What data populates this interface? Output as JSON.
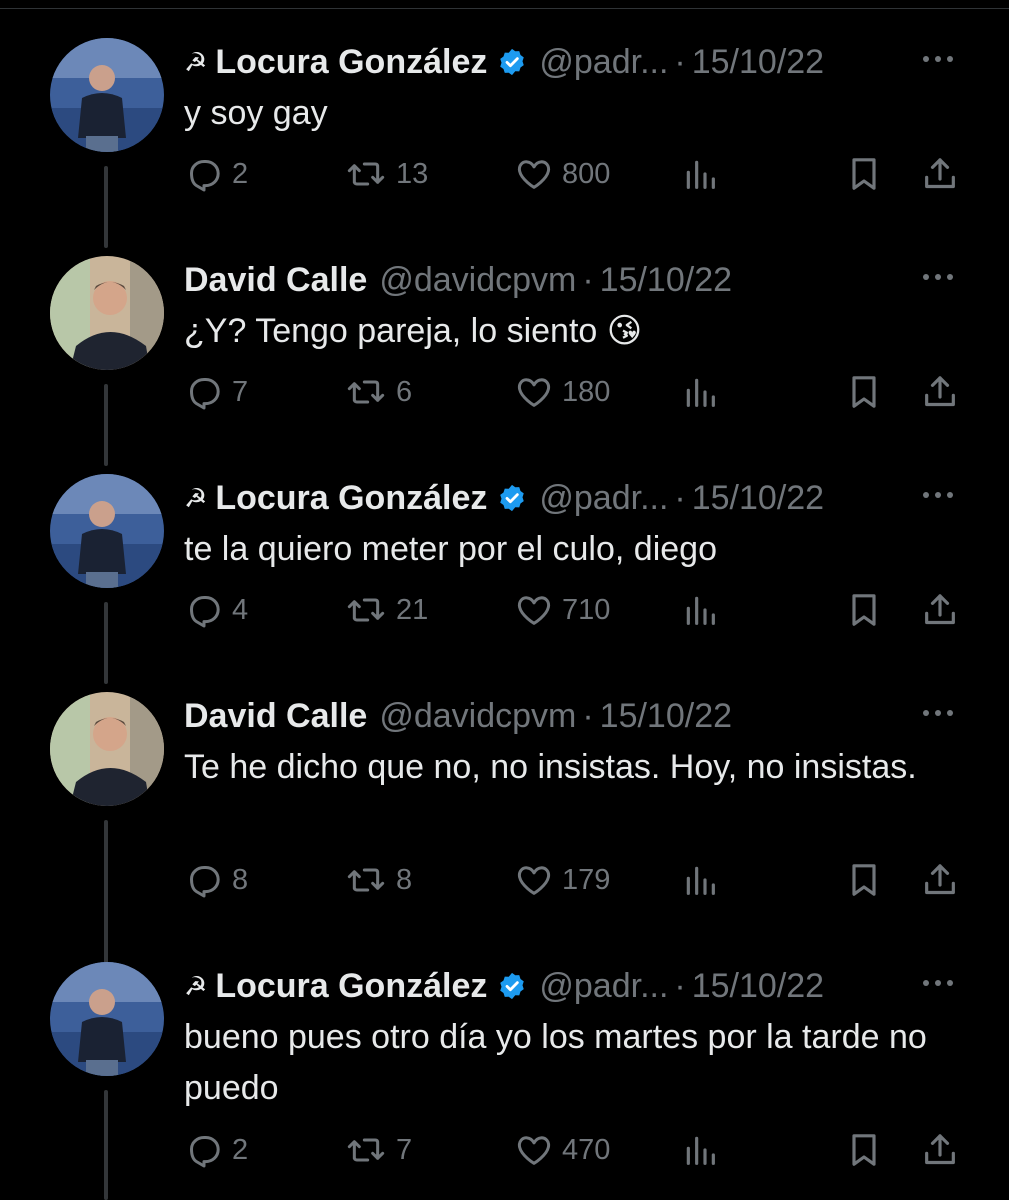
{
  "tweets": [
    {
      "name": "Locura González",
      "prefix_icon": "hammer-sickle-icon",
      "verified": true,
      "handle": "@padr...",
      "sep": "·",
      "date": "15/10/22",
      "text": "y soy gay",
      "replies": "2",
      "retweets": "13",
      "likes": "800",
      "avatar": "locura"
    },
    {
      "name": "David Calle",
      "prefix_icon": "",
      "verified": false,
      "handle": "@davidcpvm",
      "sep": "·",
      "date": "15/10/22",
      "text": "¿Y? Tengo pareja, lo siento 😘",
      "replies": "7",
      "retweets": "6",
      "likes": "180",
      "avatar": "david"
    },
    {
      "name": "Locura González",
      "prefix_icon": "hammer-sickle-icon",
      "verified": true,
      "handle": "@padr...",
      "sep": "·",
      "date": "15/10/22",
      "text": "te la quiero meter por el culo, diego",
      "replies": "4",
      "retweets": "21",
      "likes": "710",
      "avatar": "locura"
    },
    {
      "name": "David Calle",
      "prefix_icon": "",
      "verified": false,
      "handle": "@davidcpvm",
      "sep": "·",
      "date": "15/10/22",
      "text": "Te he dicho que no, no insistas. Hoy, no insistas.",
      "replies": "8",
      "retweets": "8",
      "likes": "179",
      "avatar": "david"
    },
    {
      "name": "Locura González",
      "prefix_icon": "hammer-sickle-icon",
      "verified": true,
      "handle": "@padr...",
      "sep": "·",
      "date": "15/10/22",
      "text": "bueno pues otro día yo los martes por la tarde no puedo",
      "replies": "2",
      "retweets": "7",
      "likes": "470",
      "avatar": "locura"
    }
  ],
  "colors": {
    "background": "#000000",
    "text": "#e7e9ea",
    "muted": "#71767b",
    "verified": "#1d9bf0",
    "thread_line": "#333639"
  }
}
